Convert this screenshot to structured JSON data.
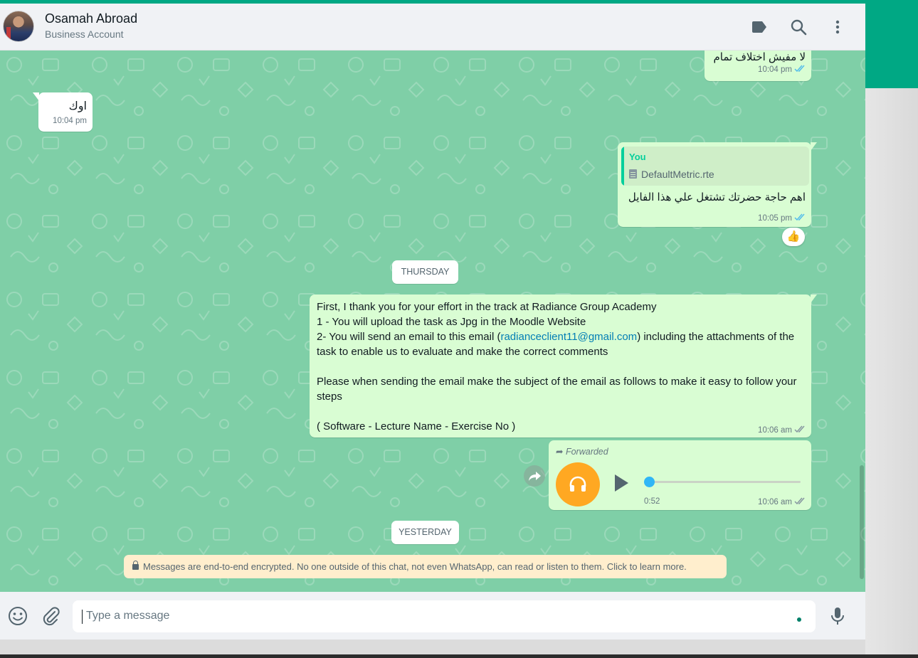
{
  "header": {
    "contact_name": "Osamah Abroad",
    "contact_subtitle": "Business Account"
  },
  "messages": [
    {
      "id": "m1",
      "direction": "outgoing",
      "text": "لا مفيش اختلاف تمام",
      "time": "10:04 pm",
      "status": "read"
    },
    {
      "id": "m2",
      "direction": "incoming",
      "text": "اوك",
      "time": "10:04 pm"
    },
    {
      "id": "m3",
      "direction": "outgoing",
      "quote": {
        "sender": "You",
        "file_name": "DefaultMetric.rte"
      },
      "text": "اهم حاجة حضرتك تشتغل علي هذا الفايل",
      "time": "10:05 pm",
      "status": "read",
      "reaction": "👍"
    },
    {
      "id": "m4",
      "direction": "outgoing",
      "text_before_link": "First, I thank you for your effort in the track at Radiance Group Academy\n1 - You will upload the task as Jpg in the Moodle Website\n2- You will send an email to this email (",
      "link": "radianceclient11@gmail.com",
      "text_after_link": ") including the attachments of the task to enable us to evaluate and make the correct comments\n\nPlease when sending the email make the subject of the email as follows to make it easy to follow your steps\n\n( Software - Lecture Name - Exercise No )",
      "time": "10:06 am",
      "status": "delivered"
    },
    {
      "id": "m5",
      "direction": "outgoing",
      "type": "voice",
      "forwarded_label": "Forwarded",
      "duration": "0:52",
      "time": "10:06 am",
      "status": "delivered",
      "progress": 0.0
    }
  ],
  "day_separators": [
    "THURSDAY",
    "YESTERDAY"
  ],
  "encryption_notice": "Messages are end-to-end encrypted. No one outside of this chat, not even WhatsApp, can read or listen to them. Click to learn more.",
  "composer": {
    "placeholder": "Type a message"
  },
  "icons": {
    "header": [
      "label-icon",
      "search-icon",
      "menu-icon"
    ],
    "footer": [
      "emoji-icon",
      "attach-icon",
      "mic-icon"
    ]
  },
  "colors": {
    "accent": "#00a884",
    "outgoing_bubble": "#d9fdd3",
    "incoming_bubble": "#ffffff",
    "chat_background": "#7fcfa7",
    "read_ticks": "#53bdeb",
    "link": "#027eb5",
    "voice_avatar": "#ffa822"
  }
}
